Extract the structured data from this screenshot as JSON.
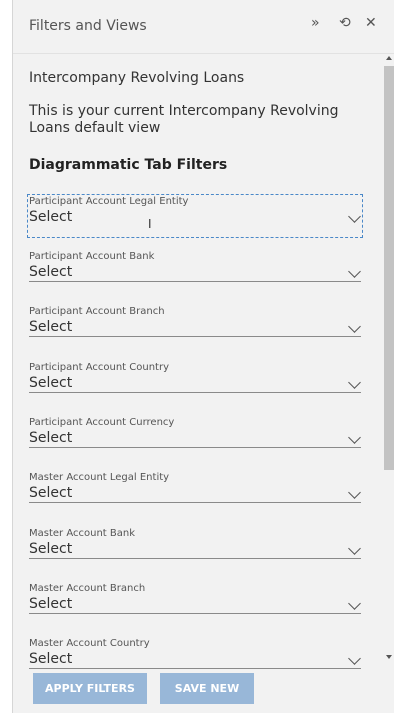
{
  "header": {
    "title": "Filters and Views",
    "icons": [
      "double-chevron-right-icon",
      "history-icon",
      "close-icon"
    ]
  },
  "content": {
    "report_name": "Intercompany Revolving Loans",
    "default_view_text": "This is your current Intercompany Revolving Loans default view",
    "section_title": "Diagrammatic Tab Filters"
  },
  "filters": [
    {
      "label": "Participant Account Legal Entity",
      "value": "Select"
    },
    {
      "label": "Participant Account Bank",
      "value": "Select"
    },
    {
      "label": "Participant Account Branch",
      "value": "Select"
    },
    {
      "label": "Participant Account Country",
      "value": "Select"
    },
    {
      "label": "Participant Account Currency",
      "value": "Select"
    },
    {
      "label": "Master Account Legal Entity",
      "value": "Select"
    },
    {
      "label": "Master Account Bank",
      "value": "Select"
    },
    {
      "label": "Master Account Branch",
      "value": "Select"
    },
    {
      "label": "Master Account Country",
      "value": "Select"
    }
  ],
  "footer": {
    "apply_label": "APPLY FILTERS",
    "save_label": "SAVE NEW"
  },
  "colors": {
    "button": "#98b7d8",
    "panel_bg": "#f2f2f2",
    "focus_outline": "#4a88c8"
  }
}
